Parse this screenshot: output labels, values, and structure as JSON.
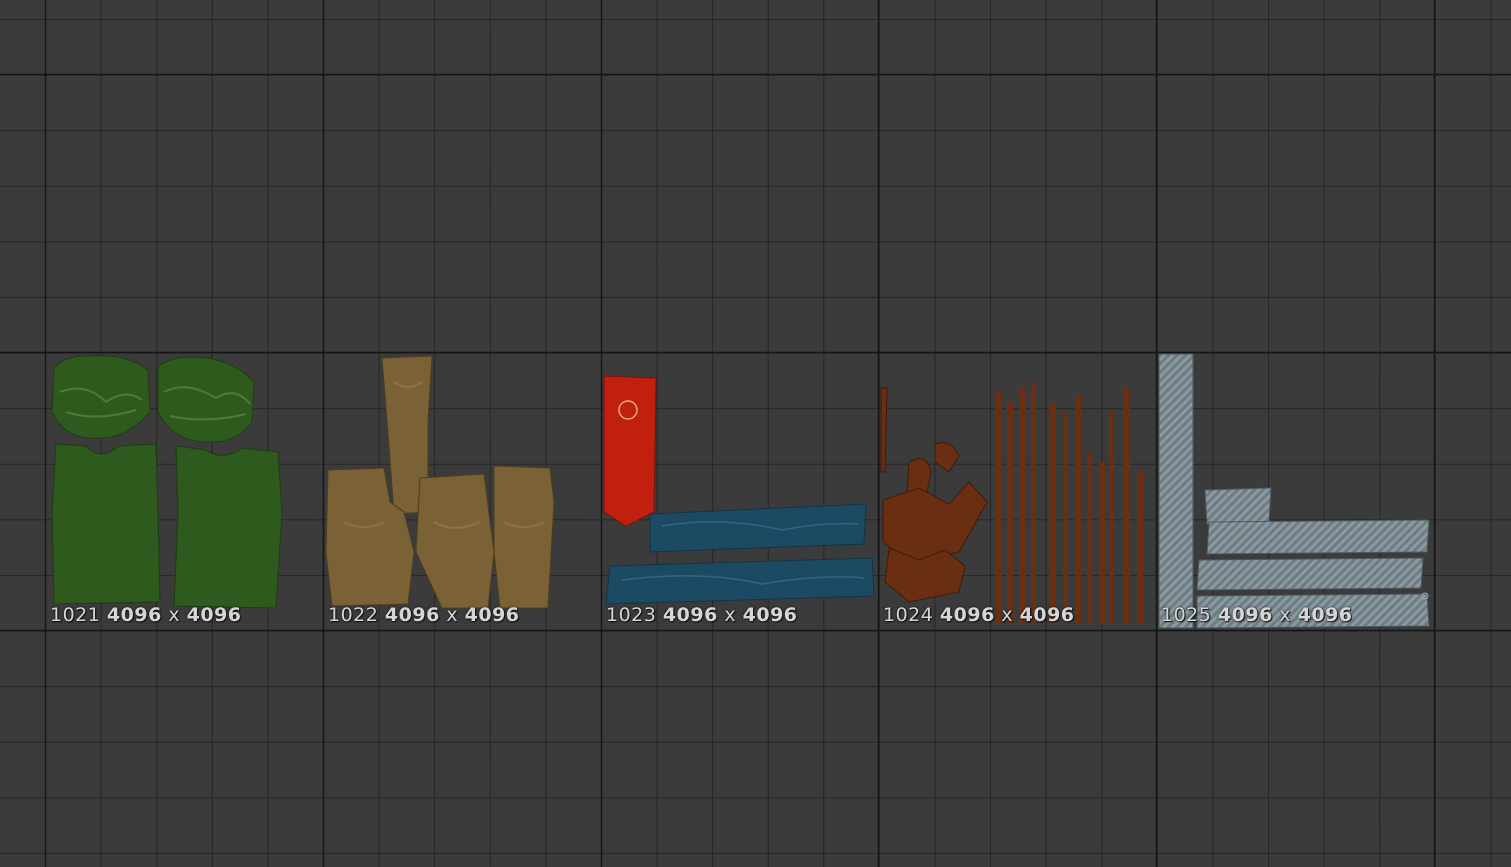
{
  "editor": {
    "background_color": "#3b3b3b",
    "grid_color": "#141414"
  },
  "tiles": [
    {
      "udim": "1021",
      "width": "4096",
      "sep": "x",
      "height": "4096",
      "texture_color": "#2f5a1f"
    },
    {
      "udim": "1022",
      "width": "4096",
      "sep": "x",
      "height": "4096",
      "texture_color": "#7a6236"
    },
    {
      "udim": "1023",
      "width": "4096",
      "sep": "x",
      "height": "4096",
      "texture_color": "#1f4b63"
    },
    {
      "udim": "1024",
      "width": "4096",
      "sep": "x",
      "height": "4096",
      "texture_color": "#6a2e12"
    },
    {
      "udim": "1025",
      "width": "4096",
      "sep": "x",
      "height": "4096",
      "texture_color": "#6e7d83"
    }
  ]
}
